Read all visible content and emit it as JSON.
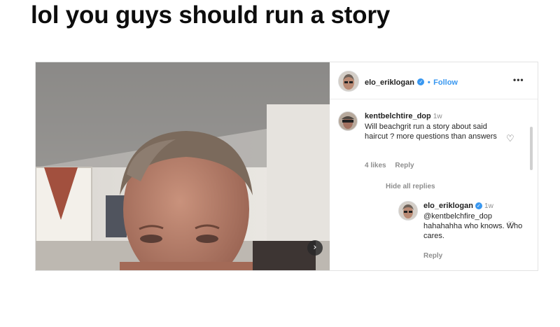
{
  "caption": "lol you guys should run a story",
  "post": {
    "author": {
      "username": "elo_eriklogan",
      "verified": true,
      "follow_separator": "•",
      "follow_label": "Follow"
    },
    "more_options": "•••",
    "next_icon": "›",
    "comments": [
      {
        "username": "kentbelchtire_dop",
        "time": "1w",
        "text": "Will beachgrit run a story about said haircut ? more questions than answers",
        "likes": "4 likes",
        "reply_label": "Reply",
        "heart_icon": "♡"
      }
    ],
    "hide_replies_label": "Hide all replies",
    "replies": [
      {
        "username": "elo_eriklogan",
        "verified": true,
        "time": "1w",
        "mention": "@kentbelchfire_dop",
        "text": "hahahahha who knows. Who cares.",
        "reply_label": "Reply",
        "heart_icon": "♡"
      }
    ]
  },
  "colors": {
    "accent": "#3897f0",
    "secondary_text": "#8e8e8e",
    "border": "#e3e3e3"
  }
}
